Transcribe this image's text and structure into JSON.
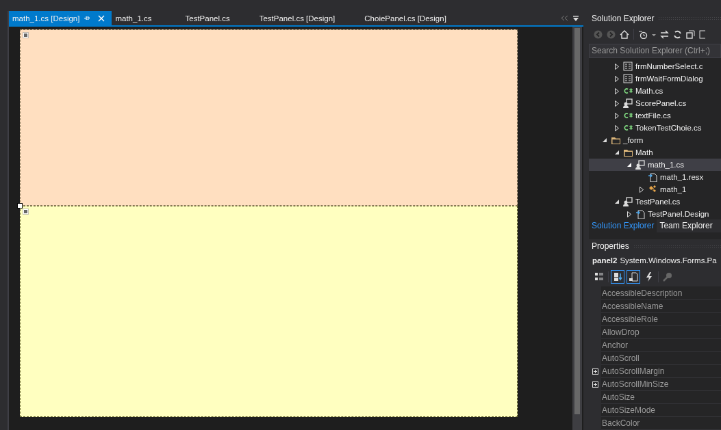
{
  "document_tabs": [
    {
      "label": "math_1.cs [Design]",
      "selected": true,
      "pinned": true
    },
    {
      "label": "math_1.cs",
      "selected": false,
      "pinned": false
    },
    {
      "label": "TestPanel.cs",
      "selected": false,
      "pinned": false
    },
    {
      "label": "TestPanel.cs [Design]",
      "selected": false,
      "pinned": false
    },
    {
      "label": "ChoiePanel.cs [Design]",
      "selected": false,
      "pinned": false
    }
  ],
  "designer": {
    "panels": [
      {
        "color": "#ffdfc0",
        "selected": false
      },
      {
        "color": "#ffffc0",
        "selected": true
      }
    ]
  },
  "solution_explorer": {
    "title": "Solution Explorer",
    "search": {
      "placeholder": "Search Solution Explorer (Ctrl+;)"
    },
    "tree": [
      {
        "children": [
          {
            "label": "frmNumberSelect.c",
            "kind": "form",
            "expanded": false,
            "selected": false
          },
          {
            "label": "frmWaitFormDialog",
            "kind": "form",
            "expanded": false,
            "selected": false
          },
          {
            "label": "Math.cs",
            "kind": "csharp",
            "expanded": false,
            "selected": false
          },
          {
            "label": "ScorePanel.cs",
            "kind": "usercontrol",
            "expanded": false,
            "selected": false
          },
          {
            "label": "textFile.cs",
            "kind": "csharp",
            "expanded": false,
            "selected": false
          },
          {
            "label": "TokenTestChoie.cs",
            "kind": "csharp",
            "expanded": false,
            "selected": false
          }
        ]
      },
      {
        "label": "_form",
        "kind": "folder",
        "expanded": true,
        "selected": false,
        "children": [
          {
            "label": "Math",
            "kind": "folder",
            "expanded": true,
            "selected": false,
            "children": [
              {
                "label": "math_1.cs",
                "kind": "usercontrol",
                "expanded": true,
                "selected": true,
                "children": [
                  {
                    "label": "math_1.resx",
                    "kind": "resource",
                    "selected": false
                  },
                  {
                    "label": "math_1",
                    "kind": "class",
                    "expanded": false,
                    "selected": false
                  }
                ]
              }
            ]
          },
          {
            "label": "TestPanel.cs",
            "kind": "usercontrol",
            "expanded": true,
            "selected": false,
            "children": [
              {
                "label": "TestPanel.Design",
                "kind": "resource",
                "expanded": false,
                "selected": false
              }
            ]
          }
        ]
      }
    ],
    "bottom_tabs": [
      {
        "label": "Solution Explorer",
        "selected": true
      },
      {
        "label": "Team Explorer",
        "selected": false
      }
    ]
  },
  "properties": {
    "title": "Properties",
    "object_name": "panel2",
    "object_type": "System.Windows.Forms.Pa",
    "toolbar": [
      {
        "kind": "categorized",
        "selected": false
      },
      {
        "kind": "alphabetical",
        "selected": true
      },
      {
        "kind": "properties",
        "selected": true
      },
      {
        "kind": "events",
        "selected": false
      },
      {
        "kind": "pages",
        "selected": false
      }
    ],
    "rows": [
      {
        "name": "AccessibleDescription",
        "expandable": false
      },
      {
        "name": "AccessibleName",
        "expandable": false
      },
      {
        "name": "AccessibleRole",
        "expandable": false
      },
      {
        "name": "AllowDrop",
        "expandable": false
      },
      {
        "name": "Anchor",
        "expandable": false
      },
      {
        "name": "AutoScroll",
        "expandable": false
      },
      {
        "name": "AutoScrollMargin",
        "expandable": true
      },
      {
        "name": "AutoScrollMinSize",
        "expandable": true
      },
      {
        "name": "AutoSize",
        "expandable": false
      },
      {
        "name": "AutoSizeMode",
        "expandable": false
      },
      {
        "name": "BackColor",
        "expandable": false
      }
    ]
  }
}
